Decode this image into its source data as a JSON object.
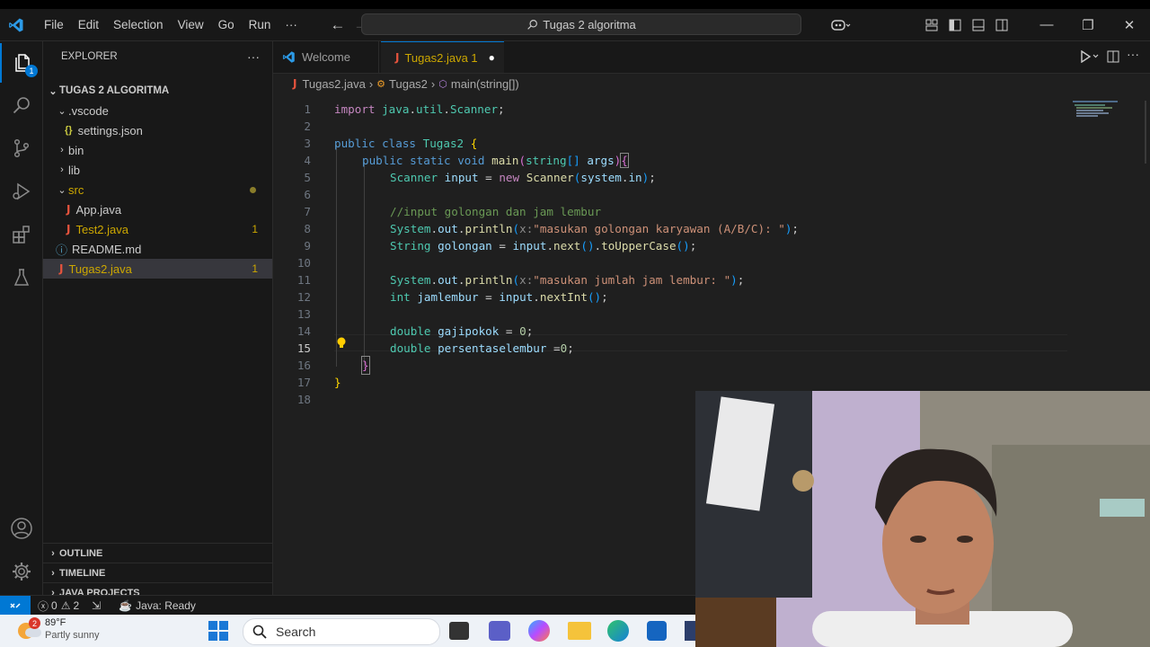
{
  "menu": [
    "File",
    "Edit",
    "Selection",
    "View",
    "Go",
    "Run",
    "···"
  ],
  "command_center": "Tugas 2 algoritma",
  "window_controls": {
    "minimize": "—",
    "maximize": "❐",
    "close": "✕"
  },
  "activity_bar": {
    "explorer_badge": "1"
  },
  "sidebar": {
    "title": "EXPLORER",
    "more": "···",
    "project": "TUGAS 2 ALGORITMA",
    "items": [
      {
        "label": ".vscode",
        "type": "folder",
        "open": true,
        "depth": 1
      },
      {
        "label": "settings.json",
        "type": "json",
        "depth": 2,
        "icon": "{}"
      },
      {
        "label": "bin",
        "type": "folder",
        "open": false,
        "depth": 1
      },
      {
        "label": "lib",
        "type": "folder",
        "open": false,
        "depth": 1
      },
      {
        "label": "src",
        "type": "folder",
        "open": true,
        "depth": 1
      },
      {
        "label": "App.java",
        "type": "java",
        "depth": 2
      },
      {
        "label": "Test2.java",
        "type": "java",
        "depth": 2,
        "count": "1"
      },
      {
        "label": "README.md",
        "type": "md",
        "depth": 1,
        "icon": "ⓘ"
      },
      {
        "label": "Tugas2.java",
        "type": "java",
        "depth": 1,
        "count": "1"
      }
    ],
    "sections": [
      "OUTLINE",
      "TIMELINE",
      "JAVA PROJECTS"
    ]
  },
  "tabs": [
    {
      "label": "Welcome"
    },
    {
      "label": "Tugas2.java 1",
      "dirty": "●"
    }
  ],
  "breadcrumb": [
    "Tugas2.java",
    "Tugas2",
    "main(string[])"
  ],
  "code_lines": [
    "1",
    "2",
    "3",
    "4",
    "5",
    "6",
    "7",
    "8",
    "9",
    "10",
    "11",
    "12",
    "13",
    "14",
    "15",
    "16",
    "17",
    "18"
  ],
  "code_text": {
    "l1": "import java.util.Scanner;",
    "l3": "public class Tugas2 {",
    "l4": "public static void main(string[] args){",
    "l5": "Scanner input = new Scanner(system.in);",
    "l7": "//input golongan dan jam lembur",
    "l8": "System.out.println(x:\"masukan golongan karyawan (A/B/C): \");",
    "l9": "String golongan = input.next().toUpperCase();",
    "l11": "System.out.println(x:\"masukan jumlah jam lembur: \");",
    "l12": "int jamlembur = input.nextInt();",
    "l14": "double gajipokok = 0;",
    "l15": "double persentaselembur =0;",
    "l16": "}",
    "l17": "}"
  },
  "status_bar": {
    "errors": "0",
    "warnings": "2",
    "java": "Java: Ready"
  },
  "taskbar": {
    "weather_temp": "89°F",
    "weather_desc": "Partly sunny",
    "weather_badge": "2",
    "search": "Search"
  }
}
